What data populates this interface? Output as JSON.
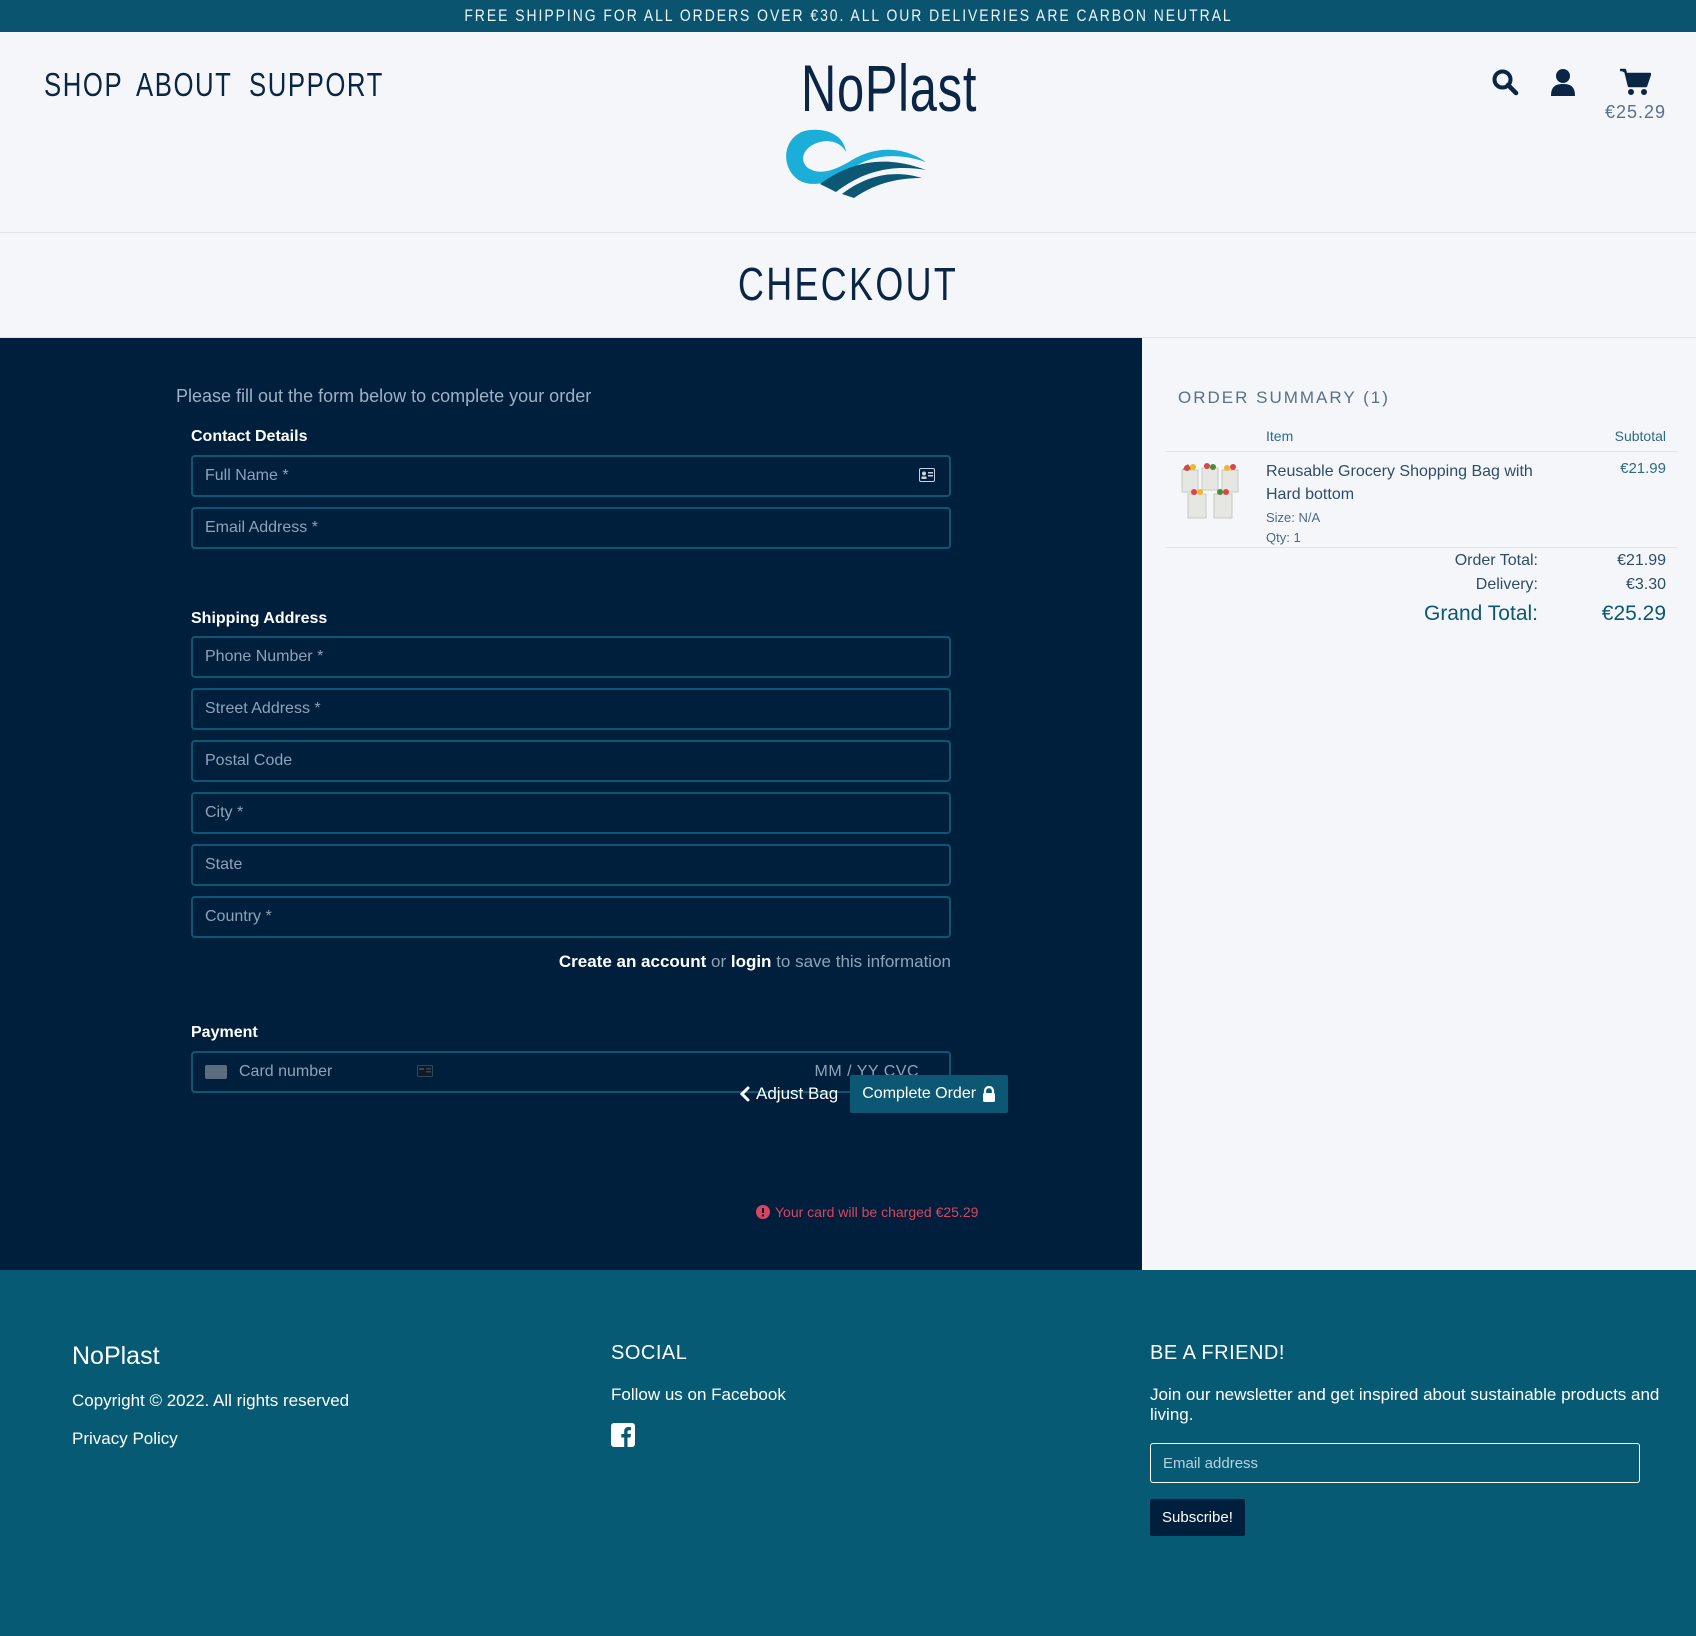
{
  "banner": {
    "text": "FREE SHIPPING FOR ALL ORDERS OVER €30. ALL OUR DELIVERIES ARE CARBON NEUTRAL"
  },
  "nav": {
    "items": [
      "SHOP",
      "ABOUT",
      "SUPPORT"
    ]
  },
  "logo": {
    "text": "NoPlast"
  },
  "header": {
    "cart_total": "€25.29",
    "icons": [
      "search-icon",
      "user-icon",
      "cart-icon"
    ]
  },
  "page": {
    "title": "CHECKOUT"
  },
  "form": {
    "intro": "Please fill out the form below to complete your order",
    "contact_label": "Contact Details",
    "full_name_placeholder": "Full Name *",
    "email_placeholder": "Email Address *",
    "shipping_label": "Shipping Address",
    "phone_placeholder": "Phone Number *",
    "street_placeholder": "Street Address *",
    "postal_placeholder": "Postal Code",
    "city_placeholder": "City *",
    "state_placeholder": "State",
    "country_placeholder": "Country *",
    "create_account": "Create an account",
    "or": "or",
    "login": "login",
    "save_info": "to save this information",
    "payment_label": "Payment",
    "card_number": "Card number",
    "card_expiry_cvc": "MM / YY  CVC",
    "adjust_bag": "Adjust Bag",
    "complete_order": "Complete Order",
    "charge_note": "Your card will be charged €25.29"
  },
  "summary": {
    "title": "ORDER SUMMARY (1)",
    "col_item": "Item",
    "col_subtotal": "Subtotal",
    "item": {
      "name": "Reusable Grocery Shopping Bag with Hard bottom",
      "size": "Size: N/A",
      "qty": "Qty: 1",
      "price": "€21.99"
    },
    "order_total_label": "Order Total:",
    "order_total": "€21.99",
    "delivery_label": "Delivery:",
    "delivery": "€3.30",
    "grand_total_label": "Grand Total:",
    "grand_total": "€25.29"
  },
  "footer": {
    "brand": "NoPlast",
    "copyright": "Copyright © 2022. All rights reserved",
    "privacy": "Privacy Policy",
    "social_title": "SOCIAL",
    "social_text": "Follow us on Facebook",
    "friend_title": "BE A FRIEND!",
    "friend_text": "Join our newsletter and get inspired about sustainable products and living.",
    "email_placeholder": "Email address",
    "subscribe": "Subscribe!"
  },
  "colors": {
    "navy": "#001f3d",
    "teal": "#075a74",
    "accent": "#0c5874",
    "wave": "#1aaed8",
    "error": "#d9455e"
  }
}
